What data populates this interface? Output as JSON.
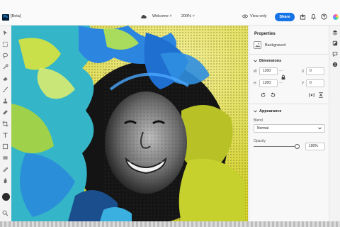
{
  "app": {
    "logo": "Ps",
    "badge": "[Beta]"
  },
  "topbar": {
    "doc_title": "Welcome",
    "zoom": "200%",
    "view_mode": "View only",
    "share_label": "Share",
    "icons": [
      "cloud-icon",
      "eye-icon",
      "download-icon",
      "bell-icon",
      "help-icon",
      "creative-cloud-icon"
    ]
  },
  "tools": [
    "move-tool",
    "marquee-tool",
    "lasso-tool",
    "quick-select-tool",
    "crop-tool",
    "brush-tool",
    "eraser-tool",
    "gradient-tool",
    "clone-stamp-tool",
    "healing-tool",
    "type-tool",
    "shape-tool",
    "eyedropper-tool",
    "hand-tool",
    "zoom-tool"
  ],
  "foreground_color": "#2b2b2b",
  "properties": {
    "title": "Properties",
    "layer_name": "Background",
    "dimensions": {
      "heading": "Dimensions",
      "w_label": "W",
      "w_value": "1200",
      "h_label": "H",
      "h_value": "1200",
      "x_label": "X",
      "x_value": "0",
      "y_label": "Y",
      "y_value": "0"
    },
    "appearance": {
      "heading": "Appearance",
      "blend_label": "Blend",
      "blend_value": "Normal",
      "opacity_label": "Opacity",
      "opacity_value": "100%",
      "opacity_fraction": 1.0
    }
  },
  "rail_icons": [
    "layers-icon",
    "adjustments-icon",
    "comments-icon",
    "info-icon"
  ],
  "colors": {
    "accent": "#1473e6",
    "ps_dark": "#001e36",
    "ps_blue": "#31a8ff"
  }
}
